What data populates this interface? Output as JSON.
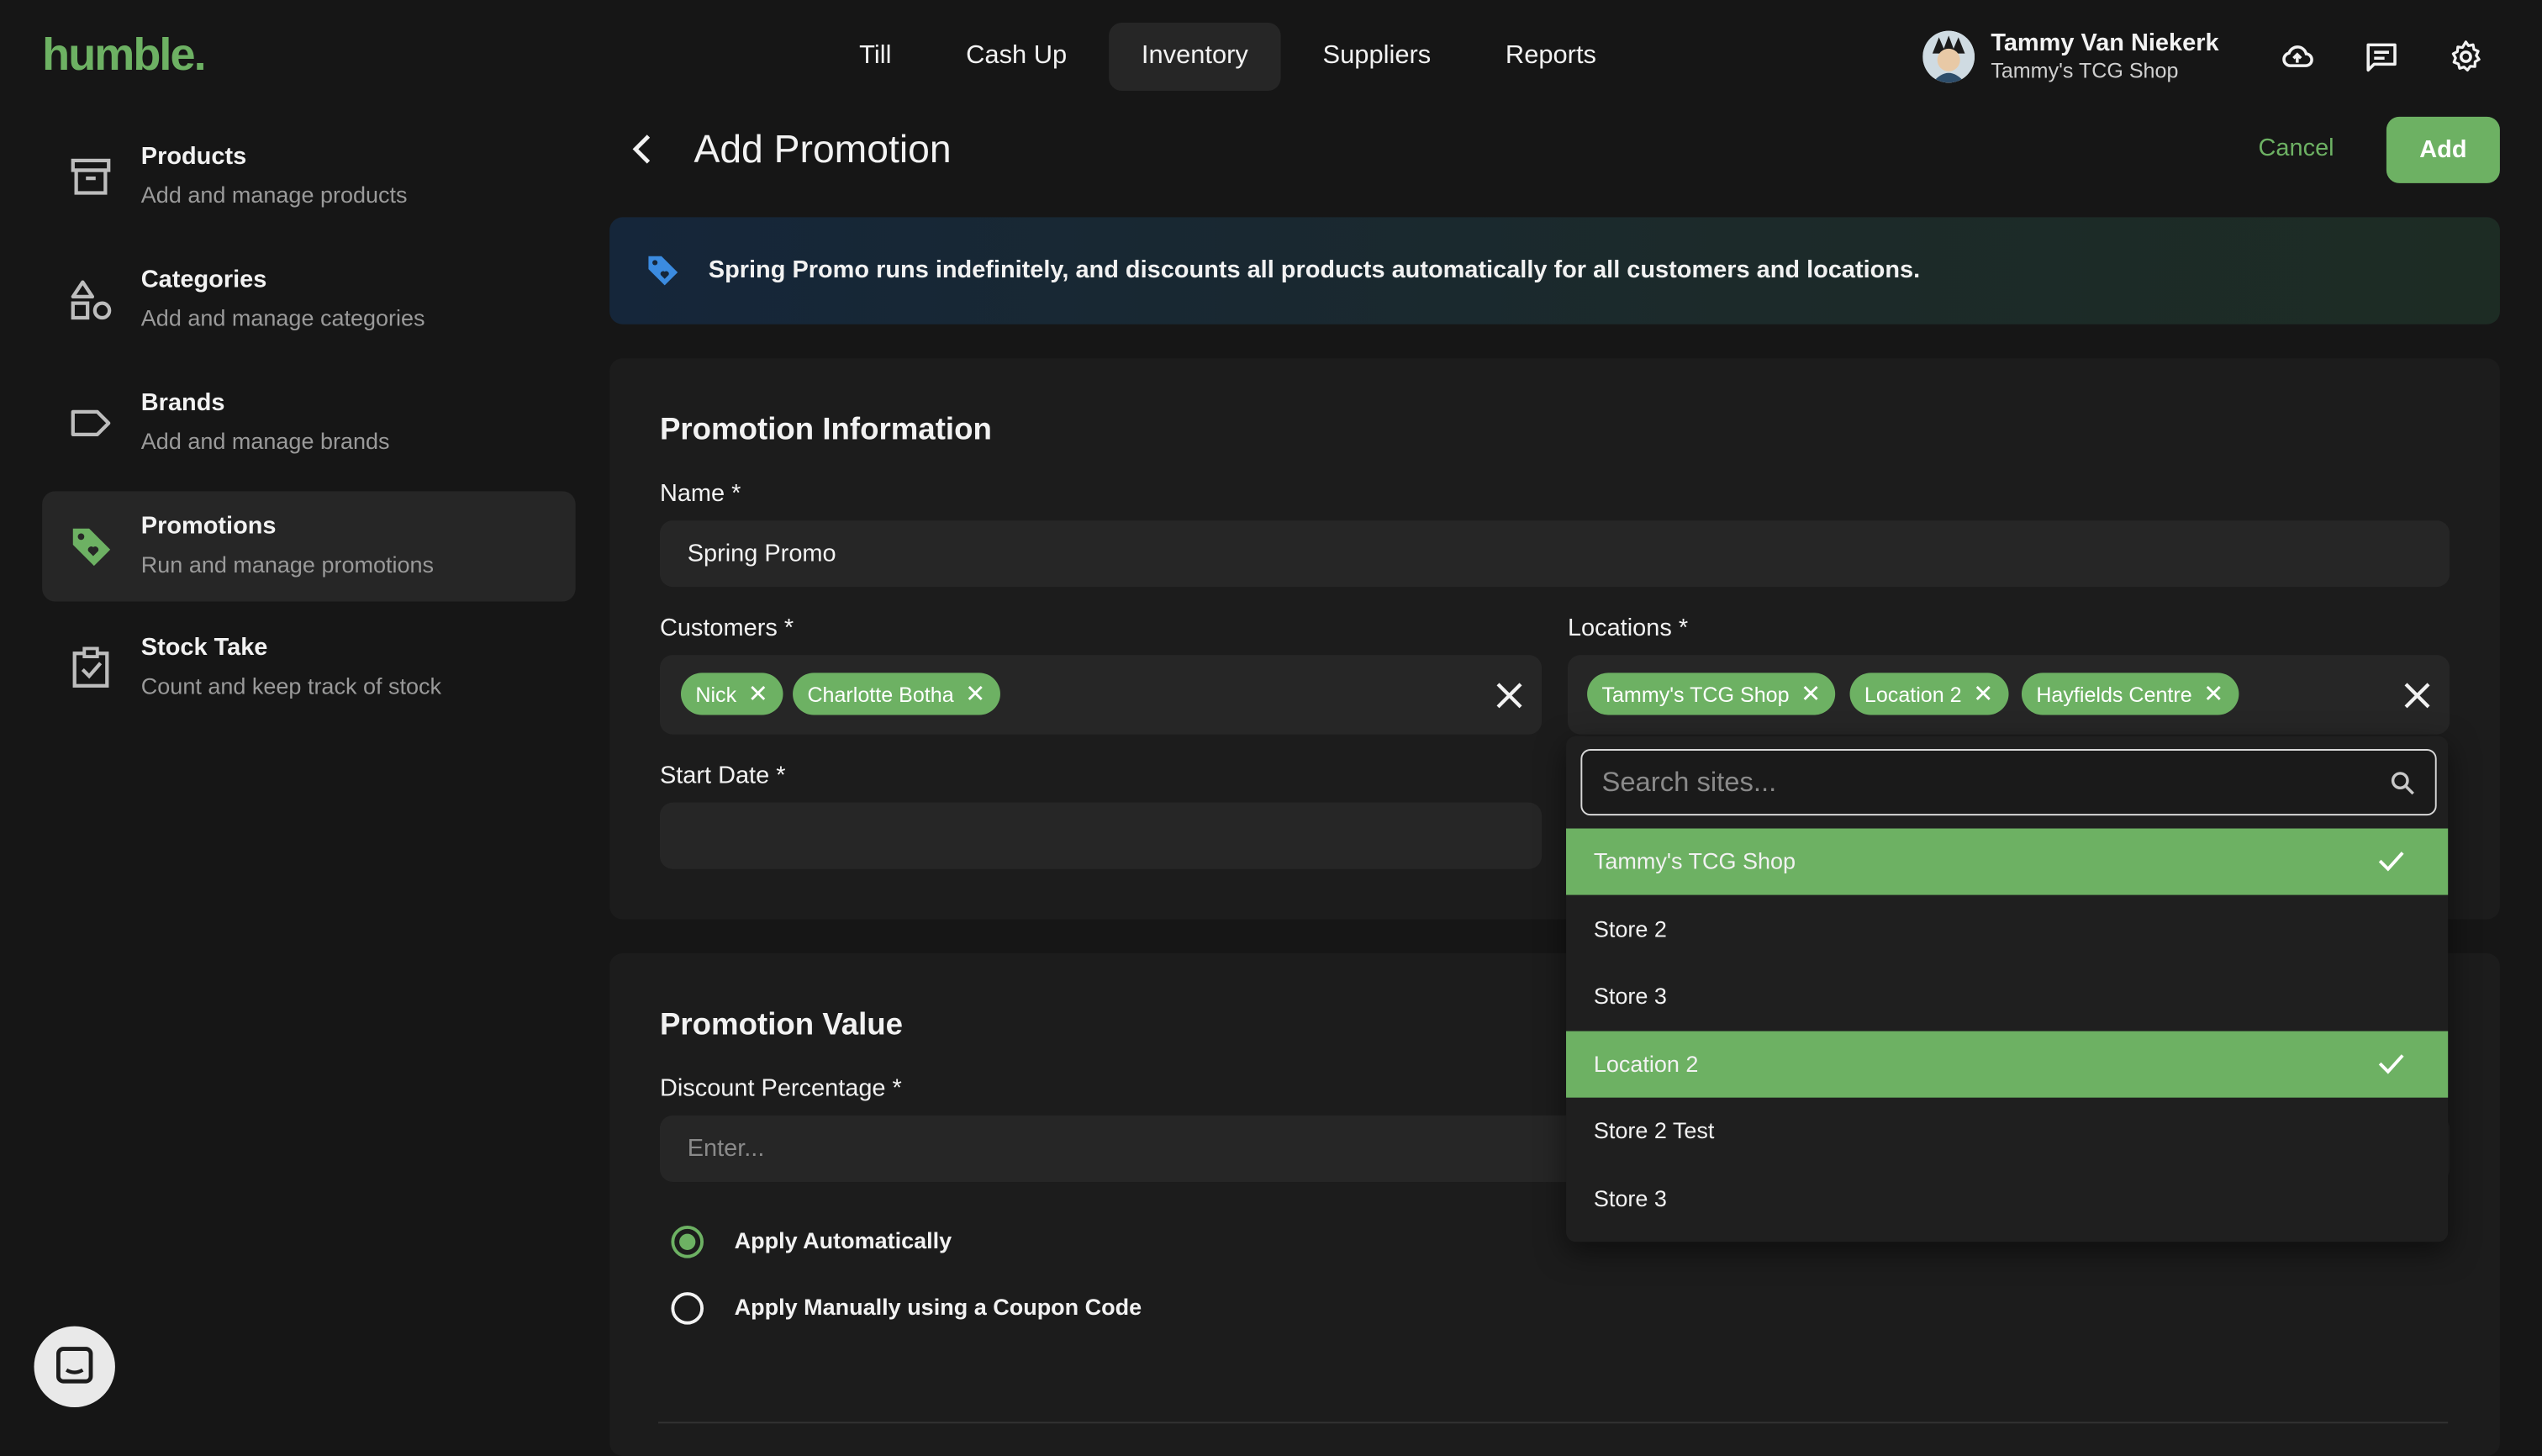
{
  "app": {
    "logo": "humble."
  },
  "nav": [
    {
      "label": "Till"
    },
    {
      "label": "Cash Up"
    },
    {
      "label": "Inventory",
      "active": true
    },
    {
      "label": "Suppliers"
    },
    {
      "label": "Reports"
    }
  ],
  "user": {
    "name": "Tammy Van Niekerk",
    "shop": "Tammy's TCG Shop"
  },
  "sidebar": {
    "items": [
      {
        "title": "Products",
        "subtitle": "Add and manage products",
        "icon": "archive-box-icon"
      },
      {
        "title": "Categories",
        "subtitle": "Add and manage categories",
        "icon": "shapes-icon"
      },
      {
        "title": "Brands",
        "subtitle": "Add and manage brands",
        "icon": "tag-outline-icon"
      },
      {
        "title": "Promotions",
        "subtitle": "Run and manage promotions",
        "icon": "tag-filled-icon",
        "active": true
      },
      {
        "title": "Stock Take",
        "subtitle": "Count and keep track of stock",
        "icon": "clipboard-check-icon"
      }
    ]
  },
  "header": {
    "title": "Add Promotion",
    "cancel_label": "Cancel",
    "add_label": "Add"
  },
  "banner": {
    "text": "Spring Promo runs indefinitely, and discounts all products automatically for all customers and locations."
  },
  "promotion_info": {
    "section_title": "Promotion Information",
    "name_label": "Name *",
    "name_value": "Spring Promo",
    "customers_label": "Customers *",
    "customers": [
      "Nick",
      "Charlotte Botha"
    ],
    "locations_label": "Locations *",
    "locations": [
      "Tammy's TCG Shop",
      "Location 2",
      "Hayfields Centre"
    ],
    "start_date_label": "Start Date *",
    "start_date_value": ""
  },
  "promotion_value": {
    "section_title": "Promotion Value",
    "discount_label": "Discount Percentage *",
    "discount_placeholder": "Enter...",
    "options": [
      {
        "label": "Apply Automatically",
        "selected": true
      },
      {
        "label": "Apply Manually using a Coupon Code",
        "selected": false
      }
    ]
  },
  "locations_dropdown": {
    "search_placeholder": "Search sites...",
    "options": [
      {
        "label": "Tammy's TCG Shop",
        "selected": true
      },
      {
        "label": "Store 2",
        "selected": false
      },
      {
        "label": "Store 3",
        "selected": false
      },
      {
        "label": "Location 2",
        "selected": true
      },
      {
        "label": "Store 2 Test",
        "selected": false
      },
      {
        "label": "Store 3",
        "selected": false
      }
    ]
  },
  "colors": {
    "accent": "#6db163",
    "background": "#161616",
    "card": "#1c1c1c",
    "field": "#262626"
  }
}
